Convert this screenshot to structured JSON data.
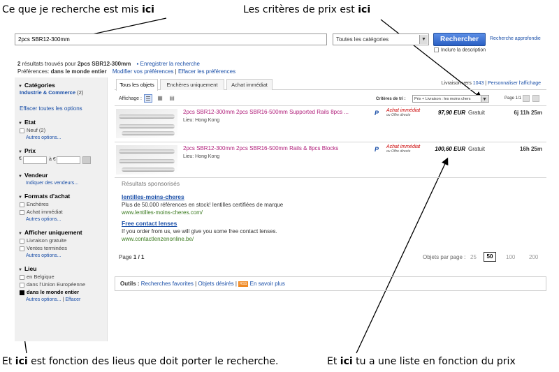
{
  "annotations": {
    "top_left": {
      "text": "Ce que je recherche  est mis ",
      "bold": "ici"
    },
    "top_right": {
      "text": "Les critères de prix est ",
      "bold": "ici"
    },
    "bottom_left": {
      "text_before": "Et ",
      "bold": "ici",
      "text_after": " est fonction  des lieus que doit porter le recherche."
    },
    "bottom_right": {
      "text_before": "Et ",
      "bold": "ici",
      "text_after": " tu a une liste en fonction du prix"
    }
  },
  "search": {
    "value": "2pcs SBR12-300mm",
    "category": "Toutes les catégories",
    "button": "Rechercher",
    "advanced": "Recherche approfondie",
    "include_desc": "Inclure la description"
  },
  "summary": {
    "count": "2",
    "found": " résultats trouvés pour ",
    "query": "2pcs SBR12-300mm",
    "save": "Enregistrer la recherche",
    "pref_label": "Préférences: ",
    "pref_value": "dans le monde entier",
    "modify": "Modifier vos préférences",
    "clear": "Effacer les préférences"
  },
  "sidebar": {
    "categories_title": "Catégories",
    "category_item": "Industrie & Commerce",
    "category_count": "(2)",
    "clear_all": "Effacer toutes les options",
    "etat": {
      "title": "Etat",
      "item": "Neuf (2)",
      "more": "Autres options..."
    },
    "prix": {
      "title": "Prix",
      "cur1": "€",
      "cur2": "à €"
    },
    "vendeur": {
      "title": "Vendeur",
      "link": "Indiquer des vendeurs..."
    },
    "formats": {
      "title": "Formats d'achat",
      "items": [
        "Enchères",
        "Achat immédiat"
      ],
      "more": "Autres options..."
    },
    "afficher": {
      "title": "Afficher uniquement",
      "items": [
        "Livraison gratuite",
        "Ventes terminées"
      ],
      "more": "Autres options..."
    },
    "lieu": {
      "title": "Lieu",
      "items": [
        "en Belgique",
        "dans l'Union Européenne",
        "dans le monde entier"
      ],
      "more": "Autres options...",
      "clear": "Effacer"
    }
  },
  "tabs": [
    "Tous les objets",
    "Enchères uniquement",
    "Achat immédiat"
  ],
  "livraison": {
    "label": "Livraison vers ",
    "value": "1043",
    "personalize": "Personnaliser l'affichage"
  },
  "toolbar": {
    "affichage": "Affichage :",
    "sort_label": "Critères de tri :",
    "sort_value": "Prix + Livraison : les moins chers",
    "page": "Page 1/1"
  },
  "results": [
    {
      "title": "2pcs SBR12-300mm 2pcs SBR16-500mm Supported Rails 8pcs ...",
      "location": "Lieu: Hong Kong",
      "price": "97,90 EUR",
      "shipping": "Gratuit",
      "time": "6j 11h 25m"
    },
    {
      "title": "2pcs SBR12-300mm 2pcs SBR16-500mm Rails & 8pcs Blocks",
      "location": "Lieu: Hong Kong",
      "price": "100,60 EUR",
      "shipping": "Gratuit",
      "time": "16h 25m"
    }
  ],
  "badge": {
    "pp": "P",
    "ai_line1": "Achat immédiat",
    "ai_line2": "ou Offre directe"
  },
  "sponsored": {
    "title": "Résultats sponsorisés",
    "ads": [
      {
        "title": "lentilles-moins-cheres",
        "desc": "Plus de 50.000 références en stock! lentilles certifiées de marque",
        "url": "www.lentilles-moins-cheres.com/"
      },
      {
        "title": "Free contact lenses",
        "desc": "If you order from us, we will give you some free contact lenses.",
        "url": "www.contactlenzenonline.be/"
      }
    ]
  },
  "pager": {
    "page_label": "Page ",
    "page_value": "1 / 1",
    "per_page": "Objets par page :",
    "options": [
      "25",
      "50",
      "100",
      "200"
    ],
    "selected": "50"
  },
  "outils": {
    "label": "Outils : ",
    "links": [
      "Recherches favorites",
      "Objets désirés"
    ],
    "rss": "RSS",
    "more": "En savoir plus"
  }
}
